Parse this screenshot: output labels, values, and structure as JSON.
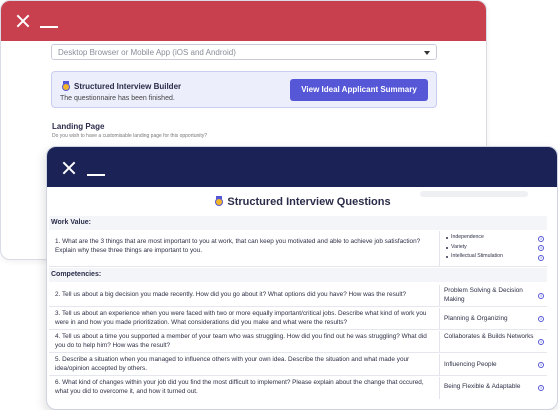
{
  "back_window": {
    "platform_select": {
      "value": "Desktop Browser or Mobile App (iOS and Android)"
    },
    "builder": {
      "title": "Structured Interview Builder",
      "subtitle": "The questionnaire has been finished.",
      "button_label": "View Ideal Applicant Summary"
    },
    "landing": {
      "title": "Landing Page",
      "subtitle": "Do you wish to have a customisable landing page for this opportunity?"
    }
  },
  "modal": {
    "title": "Structured Interview Questions",
    "sections": [
      {
        "label": "Work Value:",
        "questions": [
          {
            "text": "1. What are the 3 things that are most important to you at work, that can keep you motivated and able to achieve job satisfaction? Explain why these three things are important to you.",
            "values": [
              "Independence",
              "Variety",
              "Intellectual Stimulation"
            ]
          }
        ]
      },
      {
        "label": "Competencies:",
        "questions": [
          {
            "text": "2. Tell us about a big decision you made recently. How did you go about it? What options did you have? How was the result?",
            "tag": "Problem Solving & Decision Making"
          },
          {
            "text": "3. Tell us about an experience when you were faced with two or more equally important/critical jobs. Describe what kind of work you were in and how you made prioritization. What considerations did you make and what were the results?",
            "tag": "Planning & Organizing"
          },
          {
            "text": "4. Tell us about a time you supported a member of your team who was struggling. How did you find out he was struggling? What did you do to help him? How was the result?",
            "tag": "Collaborates & Builds Networks"
          },
          {
            "text": "5. Describe a situation when you managed to influence others with your own idea. Describe the situation and what made your idea/opinion accepted by others.",
            "tag": "Influencing People"
          },
          {
            "text": "6. What kind of changes within your job did you find the most difficult to implement? Please explain about the change that occured, what you did to overcome it, and how it turned out.",
            "tag": "Being Flexible & Adaptable"
          }
        ]
      }
    ]
  },
  "icons": {
    "close": "close-icon",
    "minimize": "minimize-icon",
    "medal": "medal-icon",
    "info": "info-icon",
    "dropdown": "chevron-down-icon"
  },
  "colors": {
    "back_header": "#c8404e",
    "front_header": "#1b2356",
    "accent": "#5557d6",
    "card_bg": "#eceefb"
  }
}
